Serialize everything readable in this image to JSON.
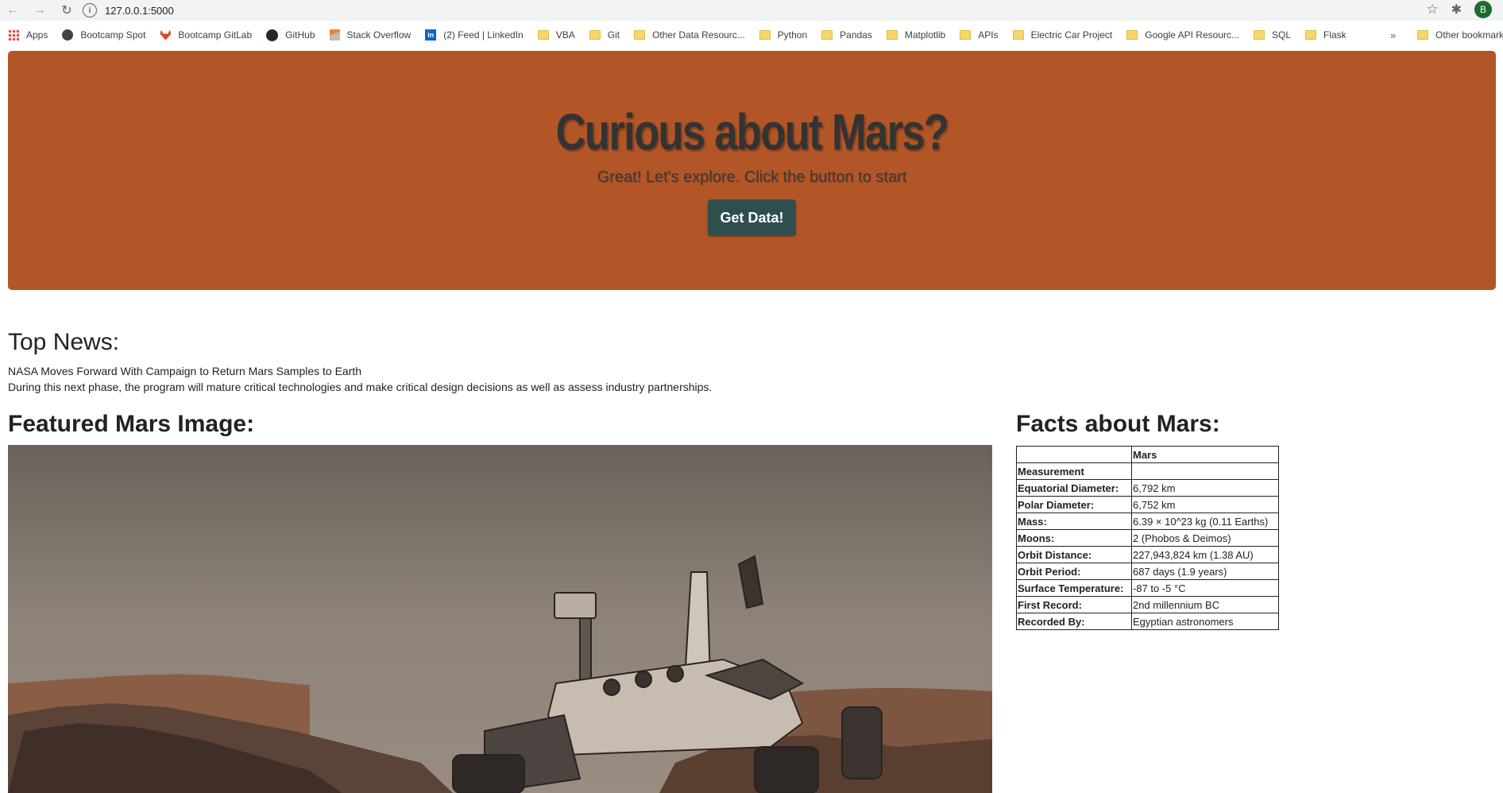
{
  "browser": {
    "url": "127.0.0.1:5000",
    "bookmarks": [
      {
        "label": "Apps",
        "icon": "apps-grid-icon"
      },
      {
        "label": "Bootcamp Spot",
        "icon": "globe-icon"
      },
      {
        "label": "Bootcamp GitLab",
        "icon": "gitlab-icon"
      },
      {
        "label": "GitHub",
        "icon": "github-icon"
      },
      {
        "label": "Stack Overflow",
        "icon": "stackoverflow-icon"
      },
      {
        "label": "(2) Feed | LinkedIn",
        "icon": "linkedin-icon"
      },
      {
        "label": "VBA",
        "icon": "folder-icon"
      },
      {
        "label": "Git",
        "icon": "folder-icon"
      },
      {
        "label": "Other Data Resourc...",
        "icon": "folder-icon"
      },
      {
        "label": "Python",
        "icon": "folder-icon"
      },
      {
        "label": "Pandas",
        "icon": "folder-icon"
      },
      {
        "label": "Matplotlib",
        "icon": "folder-icon"
      },
      {
        "label": "APIs",
        "icon": "folder-icon"
      },
      {
        "label": "Electric Car Project",
        "icon": "folder-icon"
      },
      {
        "label": "Google API Resourc...",
        "icon": "folder-icon"
      },
      {
        "label": "SQL",
        "icon": "folder-icon"
      },
      {
        "label": "Flask",
        "icon": "folder-icon"
      }
    ],
    "more_label": "»",
    "other_bookmarks": "Other bookmarks",
    "profile_initial": "B"
  },
  "hero": {
    "title": "Curious about Mars?",
    "subtitle": "Great! Let's explore. Click the button to start",
    "button_label": "Get Data!",
    "background_color": "#b35627",
    "button_color": "#2f4f4f"
  },
  "news": {
    "heading": "Top News:",
    "headline": "NASA Moves Forward With Campaign to Return Mars Samples to Earth",
    "paragraph": "During this next phase, the program will mature critical technologies and make critical design decisions as well as assess industry partnerships."
  },
  "featured_image": {
    "heading": "Featured Mars Image:"
  },
  "facts": {
    "heading": "Facts about Mars:",
    "column_header": "Mars",
    "index_header": "Measurement",
    "rows": [
      {
        "label": "Equatorial Diameter:",
        "value": "6,792 km"
      },
      {
        "label": "Polar Diameter:",
        "value": "6,752 km"
      },
      {
        "label": "Mass:",
        "value": "6.39 × 10^23 kg (0.11 Earths)"
      },
      {
        "label": "Moons:",
        "value": "2 (Phobos & Deimos)"
      },
      {
        "label": "Orbit Distance:",
        "value": "227,943,824 km (1.38 AU)"
      },
      {
        "label": "Orbit Period:",
        "value": "687 days (1.9 years)"
      },
      {
        "label": "Surface Temperature:",
        "value": "-87 to -5 °C"
      },
      {
        "label": "First Record:",
        "value": "2nd millennium BC"
      },
      {
        "label": "Recorded By:",
        "value": "Egyptian astronomers"
      }
    ]
  }
}
